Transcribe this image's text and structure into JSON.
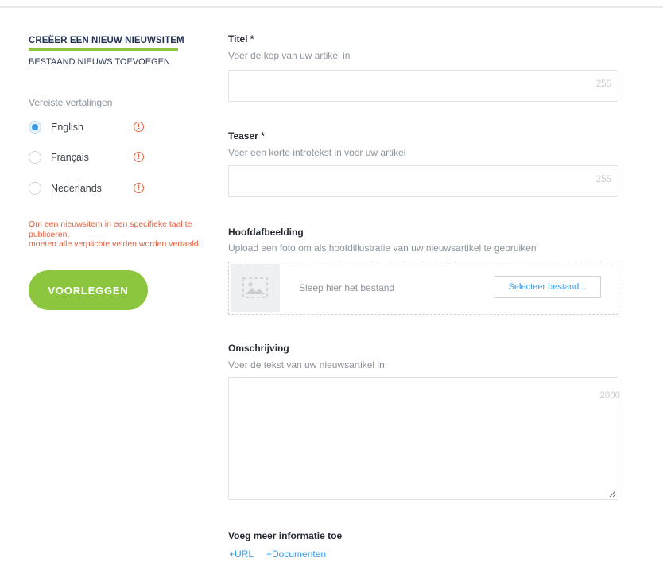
{
  "sidebar": {
    "tab_active": "CREËER EEN NIEUW NIEUWSITEM",
    "tab_inactive": "BESTAAND NIEUWS TOEVOEGEN",
    "translations_label": "Vereiste vertalingen",
    "languages": [
      {
        "label": "English",
        "selected": true
      },
      {
        "label": "Français",
        "selected": false
      },
      {
        "label": "Nederlands",
        "selected": false
      }
    ],
    "warning_glyph": "!",
    "error_line1": "Om een nieuwsitem in een specifieke taal te publiceren,",
    "error_line2": "moeten alle verplichte velden worden vertaald.",
    "submit_label": "VOORLEGGEN"
  },
  "form": {
    "title": {
      "label": "Titel *",
      "hint": "Voer de kop van uw artikel in",
      "counter": "255"
    },
    "teaser": {
      "label": "Teaser *",
      "hint": "Voer een korte introtekst in voor uw artikel",
      "counter": "255"
    },
    "image": {
      "label": "Hoofdafbeelding",
      "hint": "Upload een foto om als hoofdillustratie van uw nieuwsartikel te gebruiken",
      "drop_text": "Sleep hier het bestand",
      "select_button": "Selecteer bestand..."
    },
    "description": {
      "label": "Omschrijving",
      "hint": "Voer de tekst van uw nieuwsartikel in",
      "counter": "2000"
    },
    "more_info": {
      "label": "Voeg meer informatie toe",
      "url_link": "+URL",
      "documents_link": "+Documenten"
    }
  },
  "colors": {
    "accent_green": "#8cc63f",
    "accent_blue": "#3a9be8",
    "error_orange": "#e8603c"
  },
  "icons": {
    "warning": "warning-circle-icon",
    "image_placeholder": "image-placeholder-icon",
    "resize": "resize-grip-icon"
  }
}
